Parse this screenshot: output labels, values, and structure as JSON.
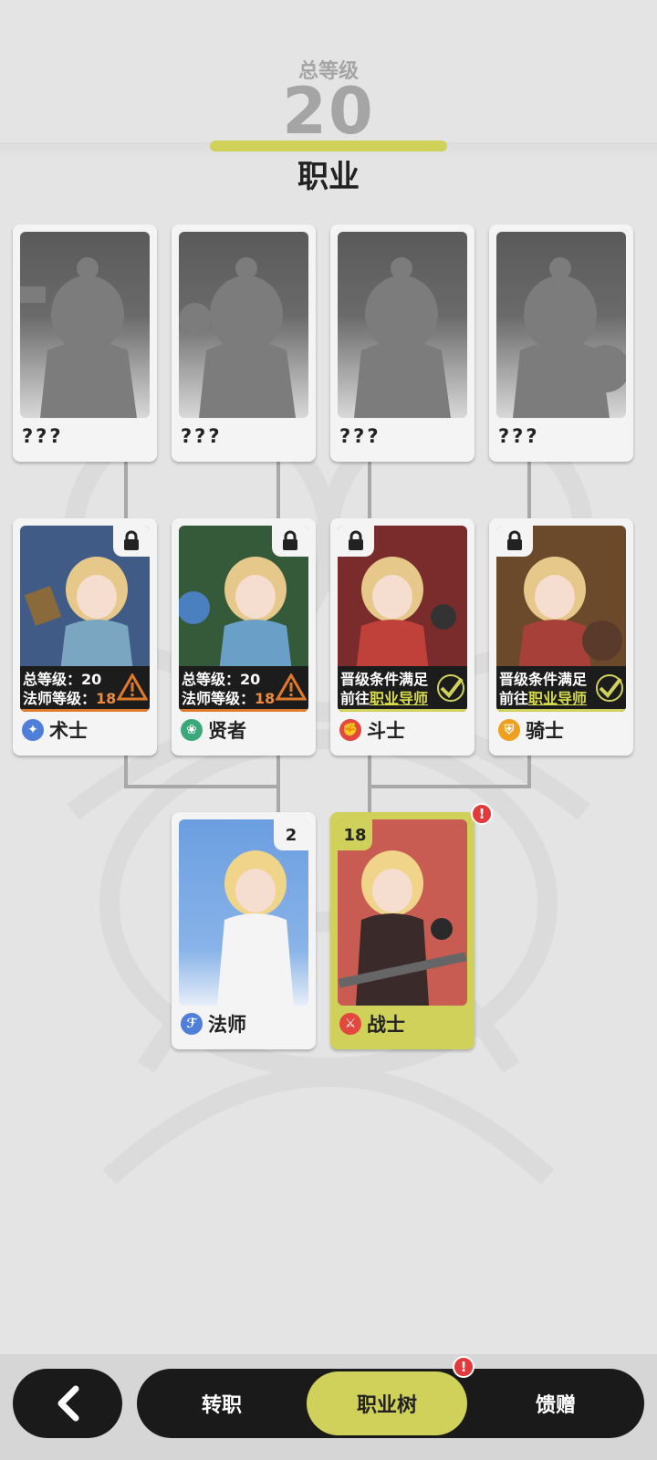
{
  "header": {
    "total_level_label": "总等级",
    "total_level_value": "20",
    "title": "职业"
  },
  "colors": {
    "accent": "#cfd15a",
    "dark": "#1a1a1a",
    "alert": "#e23a3a",
    "warning": "#e07a2a"
  },
  "unknown_classes": [
    {
      "name": "???"
    },
    {
      "name": "???"
    },
    {
      "name": "???"
    },
    {
      "name": "???"
    }
  ],
  "advanced_classes": [
    {
      "name": "术士",
      "icon": "warlock-icon",
      "locked": true,
      "condition_line1": "总等级：20",
      "condition_line2_prefix": "法师等级：",
      "condition_line2_value": "18",
      "status": "warning"
    },
    {
      "name": "贤者",
      "icon": "sage-icon",
      "locked": true,
      "condition_line1": "总等级：20",
      "condition_line2_prefix": "法师等级：",
      "condition_line2_value": "18",
      "status": "warning"
    },
    {
      "name": "斗士",
      "icon": "fighter-icon",
      "locked": true,
      "condition_line1": "晋级条件满足",
      "condition_line2_prefix": "前往",
      "condition_line2_value": "职业导师",
      "status": "ready"
    },
    {
      "name": "骑士",
      "icon": "knight-icon",
      "locked": true,
      "condition_line1": "晋级条件满足",
      "condition_line2_prefix": "前往",
      "condition_line2_value": "职业导师",
      "status": "ready"
    }
  ],
  "base_classes": [
    {
      "name": "法师",
      "icon": "mage-icon",
      "level": "2"
    },
    {
      "name": "战士",
      "icon": "warrior-icon",
      "level": "18",
      "selected": true,
      "alert": "!"
    }
  ],
  "nav": {
    "tabs": [
      {
        "label": "转职"
      },
      {
        "label": "职业树",
        "active": true,
        "alert": "!"
      },
      {
        "label": "馈赠"
      }
    ]
  }
}
